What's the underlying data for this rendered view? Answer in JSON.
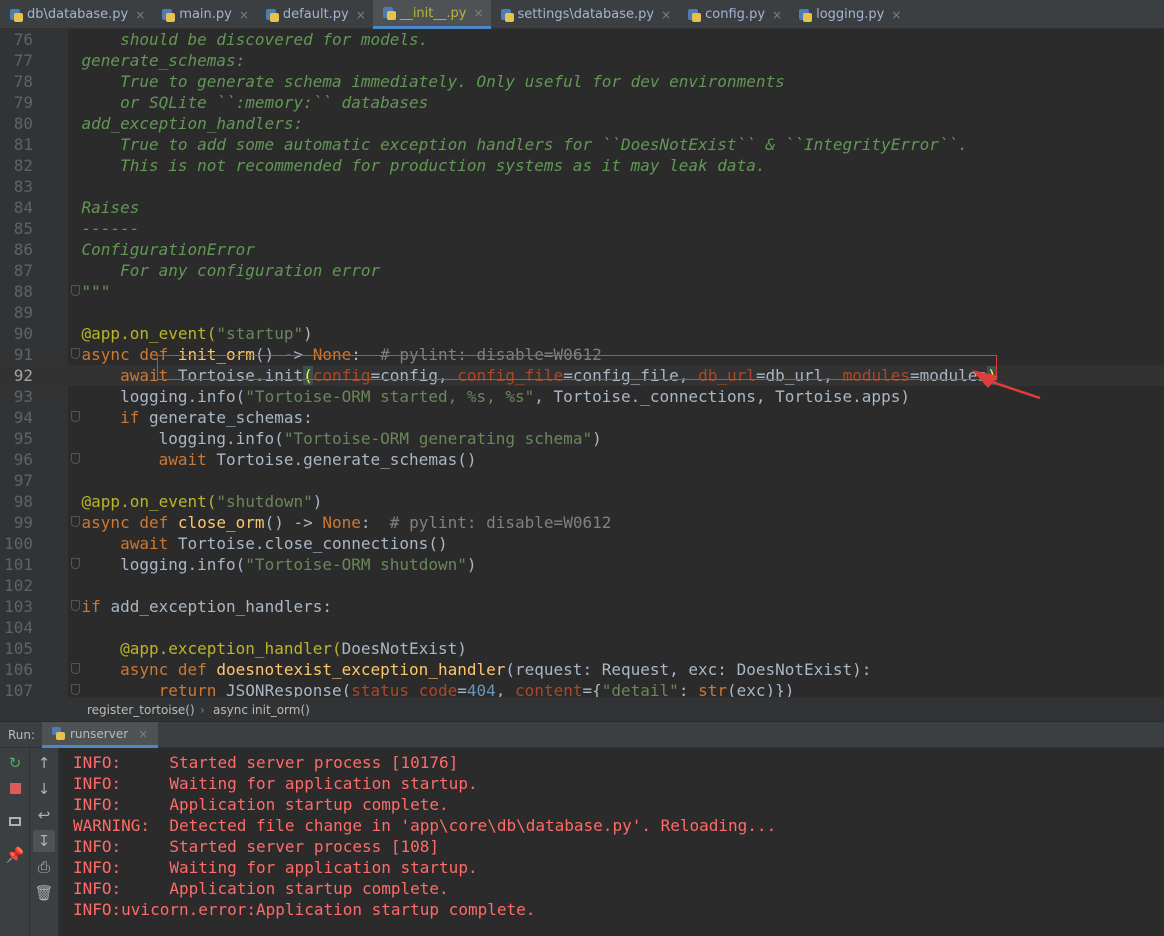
{
  "tabs": [
    {
      "name": "db\\database.py",
      "active": false
    },
    {
      "name": "main.py",
      "active": false
    },
    {
      "name": "default.py",
      "active": false
    },
    {
      "name": "__init__.py",
      "active": true
    },
    {
      "name": "settings\\database.py",
      "active": false
    },
    {
      "name": "config.py",
      "active": false
    },
    {
      "name": "logging.py",
      "active": false
    }
  ],
  "editor": {
    "current_line": 92,
    "highlighted_line": 93,
    "lines": [
      {
        "n": 76,
        "t": [
          [
            "        should be discovered for models.",
            "doc"
          ]
        ]
      },
      {
        "n": 77,
        "t": [
          [
            "    generate_schemas:",
            "doc"
          ]
        ]
      },
      {
        "n": 78,
        "t": [
          [
            "        True to generate schema immediately. Only useful for dev environments",
            "doc"
          ]
        ]
      },
      {
        "n": 79,
        "t": [
          [
            "        or SQLite ``:memory:`` databases",
            "doc"
          ]
        ]
      },
      {
        "n": 80,
        "t": [
          [
            "    add_exception_handlers:",
            "doc"
          ]
        ]
      },
      {
        "n": 81,
        "t": [
          [
            "        True to add some automatic exception handlers for ``DoesNotExist`` & ``IntegrityError``.",
            "doc"
          ]
        ]
      },
      {
        "n": 82,
        "t": [
          [
            "        This is not recommended for production systems as it may leak data.",
            "doc"
          ]
        ]
      },
      {
        "n": 83,
        "t": [
          [
            "",
            "doc"
          ]
        ]
      },
      {
        "n": 84,
        "t": [
          [
            "    Raises",
            "doc"
          ]
        ]
      },
      {
        "n": 85,
        "t": [
          [
            "    ------",
            "doc"
          ]
        ]
      },
      {
        "n": 86,
        "t": [
          [
            "    ConfigurationError",
            "doc"
          ]
        ]
      },
      {
        "n": 87,
        "t": [
          [
            "        For any configuration error",
            "doc"
          ]
        ]
      },
      {
        "n": 88,
        "t": [
          [
            "    \"\"\"",
            "doc"
          ]
        ],
        "fold": true
      },
      {
        "n": 89,
        "t": []
      },
      {
        "n": 90,
        "t": [
          [
            "    @app.on_event(",
            "dec"
          ],
          [
            "\"startup\"",
            "str"
          ],
          [
            ")",
            "dft"
          ]
        ]
      },
      {
        "n": 91,
        "t": [
          [
            "    async def ",
            "kw"
          ],
          [
            "init_orm",
            "fn"
          ],
          [
            "() -> ",
            "dft"
          ],
          [
            "None",
            "kw"
          ],
          [
            ":  ",
            "dft"
          ],
          [
            "# pylint: disable=W0612",
            "cmt"
          ]
        ],
        "fold": true
      },
      {
        "n": 92,
        "t": [
          [
            "        await ",
            "kw"
          ],
          [
            "Tortoise.init",
            "dft"
          ],
          [
            "(",
            "bracket"
          ],
          [
            "config",
            "param"
          ],
          [
            "=config, ",
            "dft"
          ],
          [
            "config_file",
            "param"
          ],
          [
            "=config_file, ",
            "dft"
          ],
          [
            "db_url",
            "param"
          ],
          [
            "=db_url, ",
            "dft"
          ],
          [
            "modules",
            "param"
          ],
          [
            "=modules",
            "dft"
          ],
          [
            ")",
            "bracket"
          ]
        ]
      },
      {
        "n": 93,
        "t": [
          [
            "        logging.info(",
            "dft"
          ],
          [
            "\"Tortoise-ORM started, %s, %s\"",
            "str"
          ],
          [
            ", Tortoise._connections, Tortoise.apps)",
            "dft"
          ]
        ]
      },
      {
        "n": 94,
        "t": [
          [
            "        if ",
            "kw"
          ],
          [
            "generate_schemas:",
            "dft"
          ]
        ],
        "fold": true
      },
      {
        "n": 95,
        "t": [
          [
            "            logging.info(",
            "dft"
          ],
          [
            "\"Tortoise-ORM generating schema\"",
            "str"
          ],
          [
            ")",
            "dft"
          ]
        ]
      },
      {
        "n": 96,
        "t": [
          [
            "            await ",
            "kw"
          ],
          [
            "Tortoise.generate_schemas()",
            "dft"
          ]
        ],
        "fold": true
      },
      {
        "n": 97,
        "t": []
      },
      {
        "n": 98,
        "t": [
          [
            "    @app.on_event(",
            "dec"
          ],
          [
            "\"shutdown\"",
            "str"
          ],
          [
            ")",
            "dft"
          ]
        ]
      },
      {
        "n": 99,
        "t": [
          [
            "    async def ",
            "kw"
          ],
          [
            "close_orm",
            "fn"
          ],
          [
            "() -> ",
            "dft"
          ],
          [
            "None",
            "kw"
          ],
          [
            ":  ",
            "dft"
          ],
          [
            "# pylint: disable=W0612",
            "cmt"
          ]
        ],
        "fold": true
      },
      {
        "n": 100,
        "t": [
          [
            "        await ",
            "kw"
          ],
          [
            "Tortoise.close_connections()",
            "dft"
          ]
        ]
      },
      {
        "n": 101,
        "t": [
          [
            "        logging.info(",
            "dft"
          ],
          [
            "\"Tortoise-ORM shutdown\"",
            "str"
          ],
          [
            ")",
            "dft"
          ]
        ],
        "fold": true
      },
      {
        "n": 102,
        "t": []
      },
      {
        "n": 103,
        "t": [
          [
            "    if ",
            "kw"
          ],
          [
            "add_exception_handlers:",
            "dft"
          ]
        ],
        "fold": true
      },
      {
        "n": 104,
        "t": []
      },
      {
        "n": 105,
        "t": [
          [
            "        @app.exception_handler(",
            "dec"
          ],
          [
            "DoesNotExist)",
            "dft"
          ]
        ]
      },
      {
        "n": 106,
        "t": [
          [
            "        async def ",
            "kw"
          ],
          [
            "doesnotexist_exception_handler",
            "fn"
          ],
          [
            "(request: Request, exc: DoesNotExist):",
            "dft"
          ]
        ],
        "fold": true
      },
      {
        "n": 107,
        "t": [
          [
            "            return ",
            "kw"
          ],
          [
            "JSONResponse(",
            "dft"
          ],
          [
            "status_code",
            "param"
          ],
          [
            "=",
            "dft"
          ],
          [
            "404",
            "num"
          ],
          [
            ", ",
            "dft"
          ],
          [
            "content",
            "param"
          ],
          [
            "={",
            "dft"
          ],
          [
            "\"detail\"",
            "str"
          ],
          [
            ": ",
            "dft"
          ],
          [
            "str",
            "kw"
          ],
          [
            "(exc)})",
            "dft"
          ]
        ],
        "fold": true
      }
    ]
  },
  "breadcrumb": {
    "item1": "register_tortoise()",
    "sep": "›",
    "item2": "async init_orm()"
  },
  "run": {
    "label": "Run:",
    "tab": "runserver",
    "close": "×"
  },
  "console": {
    "lines": [
      "INFO:     Started server process [10176]",
      "INFO:     Waiting for application startup.",
      "INFO:     Application startup complete.",
      "WARNING:  Detected file change in 'app\\core\\db\\database.py'. Reloading...",
      "INFO:     Started server process [108]",
      "INFO:     Waiting for application startup.",
      "INFO:     Application startup complete.",
      "INFO:uvicorn.error:Application startup complete."
    ]
  },
  "colors": {
    "accent": "#4a88c7",
    "error_text": "#ff6b68",
    "annotation": "#e03c3c"
  }
}
